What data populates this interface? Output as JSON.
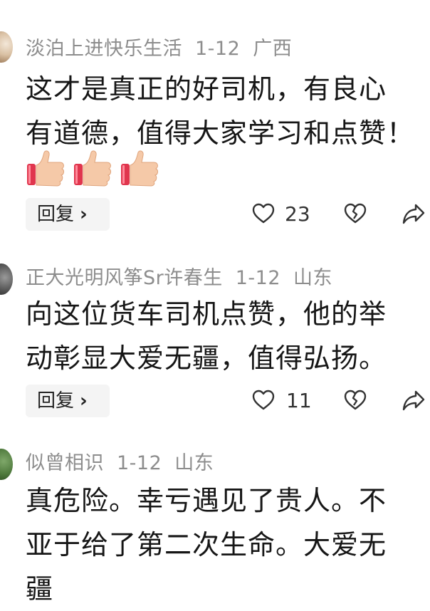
{
  "comments": [
    {
      "username": "淡泊上进快乐生活",
      "date": "1-12",
      "location": "广西",
      "lines": [
        "这才是真正的好司机，有良心",
        "有道德，值得大家学习和点赞！"
      ],
      "emoji": [
        "thumbs-up",
        "thumbs-up",
        "thumbs-up"
      ],
      "reply_label": "回复",
      "likes": "23"
    },
    {
      "username": "正大光明风筝Sr许春生",
      "date": "1-12",
      "location": "山东",
      "lines": [
        "向这位货车司机点赞，他的举",
        "动彰显大爱无疆，值得弘扬。"
      ],
      "reply_label": "回复",
      "likes": "11"
    },
    {
      "username": "似曾相识",
      "date": "1-12",
      "location": "山东",
      "lines": [
        "真危险。幸亏遇见了贵人。不",
        "亚于给了第二次生命。大爱无",
        "疆"
      ]
    }
  ],
  "icons": {
    "like": "heart-icon",
    "dislike": "broken-heart-icon",
    "share": "share-icon",
    "reply_chevron": "chevron-right-icon"
  }
}
